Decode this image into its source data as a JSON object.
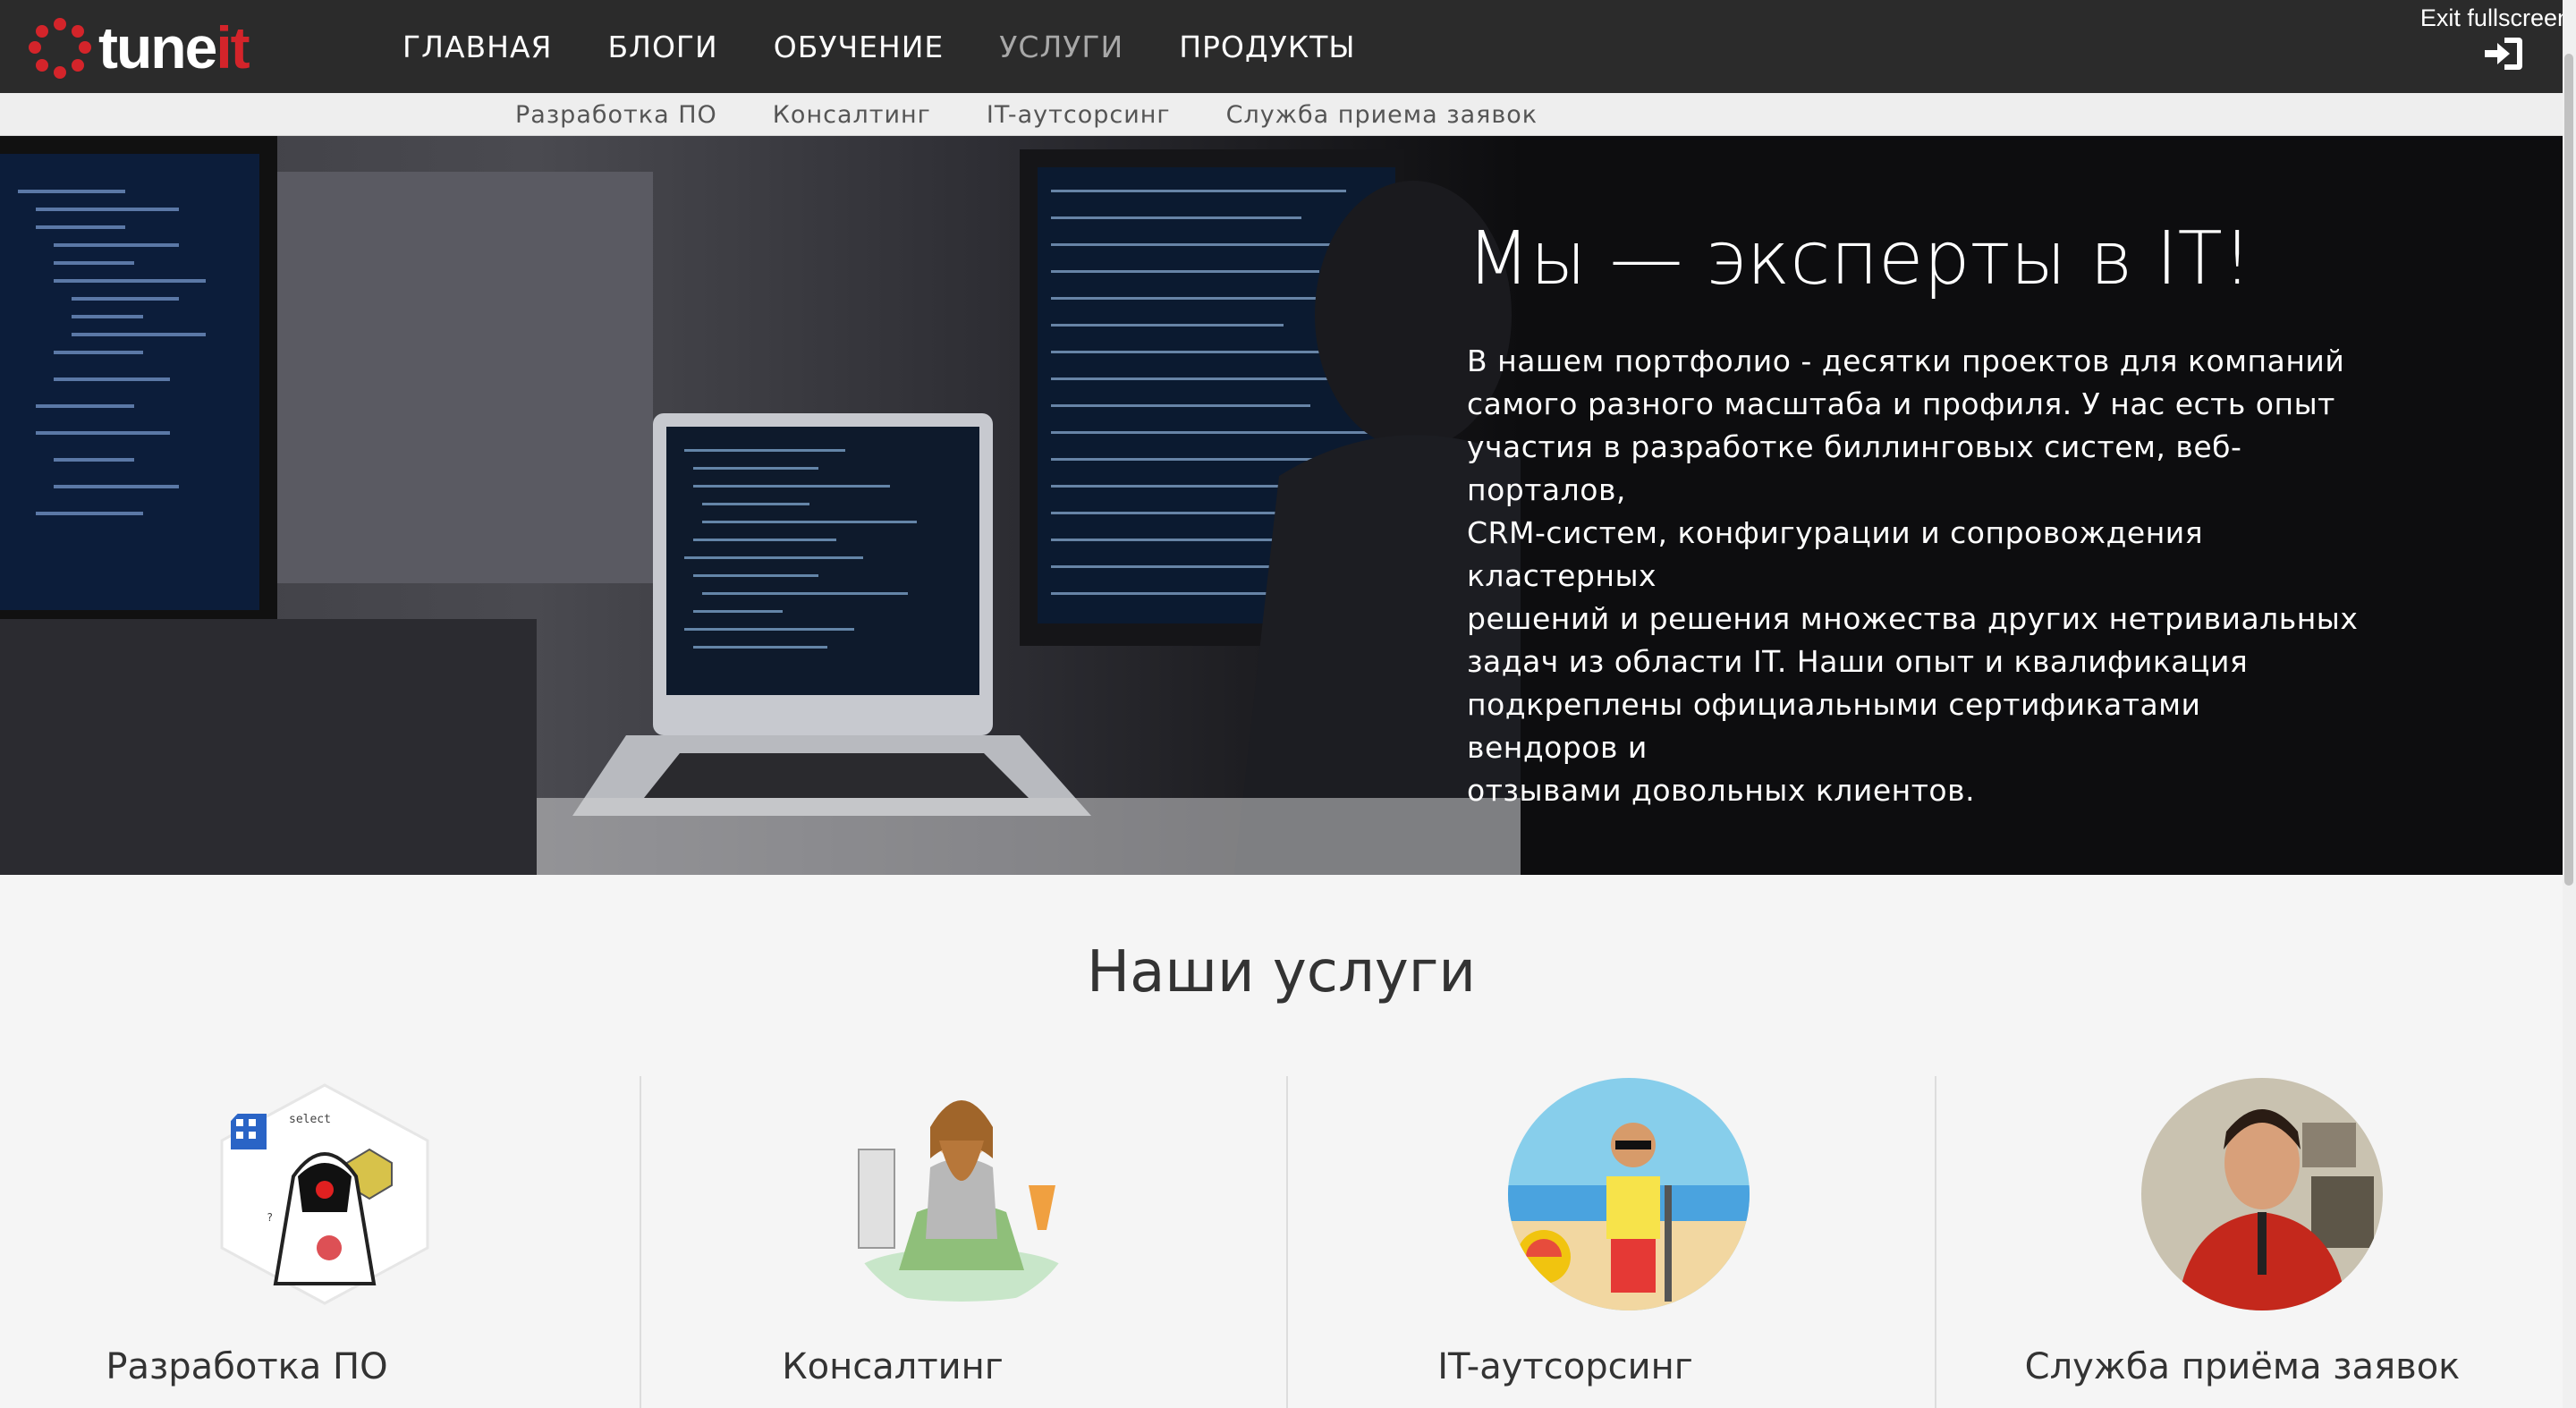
{
  "fullscreen": {
    "label": "Exit fullscreen"
  },
  "logo": {
    "tune": "tune",
    "it": "it"
  },
  "nav": {
    "items": [
      {
        "label": "ГЛАВНАЯ"
      },
      {
        "label": "БЛОГИ"
      },
      {
        "label": "ОБУЧЕНИЕ"
      },
      {
        "label": "УСЛУГИ",
        "active": true
      },
      {
        "label": "ПРОДУКТЫ"
      }
    ]
  },
  "subnav": {
    "items": [
      {
        "label": "Разработка ПО"
      },
      {
        "label": "Консалтинг"
      },
      {
        "label": "IT-аутсорсинг"
      },
      {
        "label": "Служба приема заявок"
      }
    ]
  },
  "hero": {
    "title": "Мы — эксперты в IT!",
    "lines": [
      "В нашем портфолио - десятки проектов для компаний",
      "самого разного масштаба и профиля. У нас есть опыт",
      "участия в разработке биллинговых систем, веб-порталов,",
      "CRM-систем, конфигурации и сопровождения кластерных",
      "решений и решения множества других нетривиальных",
      "задач из области IT. Наши опыт и квалификация",
      "подкреплены официальными сертификатами вендоров и",
      "отзывами довольных клиентов."
    ]
  },
  "services": {
    "title": "Наши услуги",
    "items": [
      {
        "label": "Разработка ПО"
      },
      {
        "label": "Консалтинг"
      },
      {
        "label": "IT-аутсорсинг"
      },
      {
        "label": "Служба приёма заявок"
      }
    ]
  },
  "colors": {
    "brand_red": "#d4242a",
    "topbar": "#2b2b2b"
  }
}
